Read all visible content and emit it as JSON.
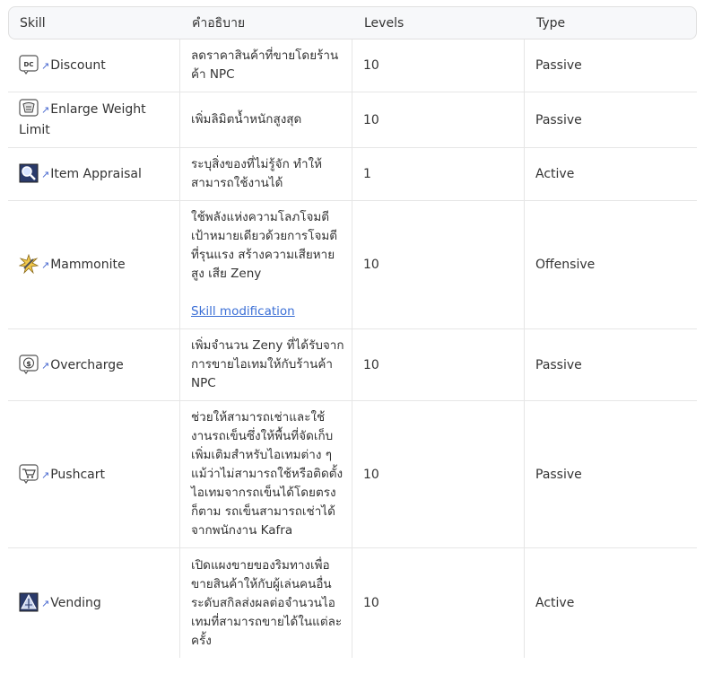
{
  "header": {
    "skill": "Skill",
    "description": "คำอธิบาย",
    "levels": "Levels",
    "type": "Type"
  },
  "rows": [
    {
      "name": "Discount",
      "icon": "discount-icon",
      "description": "ลดราคาสินค้าที่ขายโดยร้านค้า NPC",
      "levels": "10",
      "type": "Passive"
    },
    {
      "name": "Enlarge Weight Limit",
      "icon": "enlarge-weight-icon",
      "description": "เพิ่มลิมิตน้ำหนักสูงสุด",
      "levels": "10",
      "type": "Passive"
    },
    {
      "name": "Item Appraisal",
      "icon": "magnifier-icon",
      "description": "ระบุสิ่งของที่ไม่รู้จัก ทำให้สามารถใช้งานได้",
      "levels": "1",
      "type": "Active"
    },
    {
      "name": "Mammonite",
      "icon": "mammonite-icon",
      "description": "ใช้พลังแห่งความโลภโจมตีเป้าหมายเดียวด้วยการโจมตีที่รุนแรง สร้างความเสียหายสูง เสีย Zeny",
      "link": "Skill modification",
      "levels": "10",
      "type": "Offensive"
    },
    {
      "name": "Overcharge",
      "icon": "coin-icon",
      "description": "เพิ่มจำนวน Zeny ที่ได้รับจากการขายไอเทมให้กับร้านค้า NPC",
      "levels": "10",
      "type": "Passive"
    },
    {
      "name": "Pushcart",
      "icon": "cart-icon",
      "description": "ช่วยให้สามารถเช่าและใช้งานรถเข็นซึ่งให้พื้นที่จัดเก็บเพิ่มเติมสำหรับไอเทมต่าง ๆ แม้ว่าไม่สามารถใช้หรือติดตั้งไอเทมจากรถเข็นได้โดยตรงก็ตาม รถเข็นสามารถเช่าได้จากพนักงาน Kafra",
      "levels": "10",
      "type": "Passive"
    },
    {
      "name": "Vending",
      "icon": "vending-icon",
      "description": "เปิดแผงขายของริมทางเพื่อขายสินค้าให้กับผู้เล่นคนอื่น ระดับสกิลส่งผลต่อจำนวนไอเทมที่สามารถขายได้ในแต่ละครั้ง",
      "levels": "10",
      "type": "Active"
    }
  ]
}
